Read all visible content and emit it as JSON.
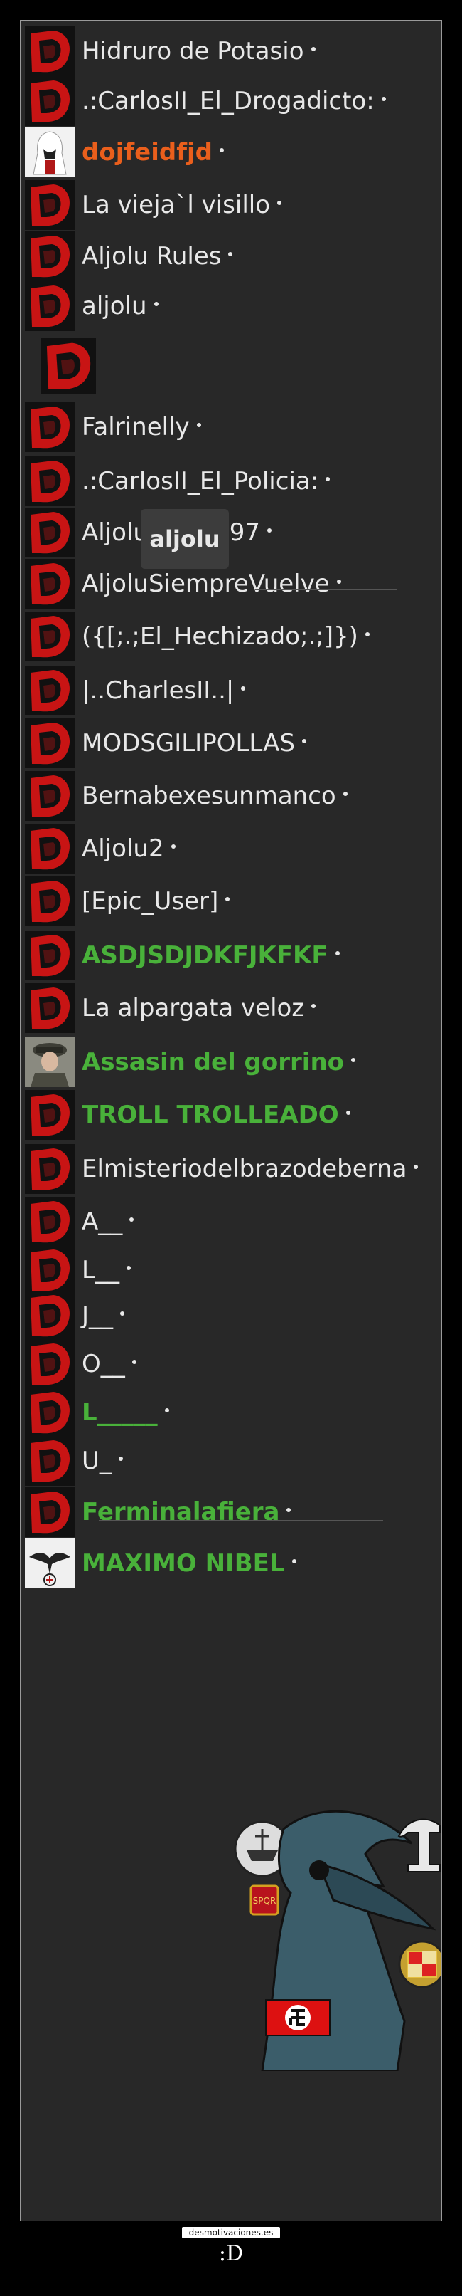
{
  "users": [
    {
      "name": "Hidruro de Potasio",
      "style": "normal",
      "avatar": "red-logo-icon"
    },
    {
      "name": ".:CarlosII_El_Drogadicto:",
      "style": "normal",
      "avatar": "red-logo-icon"
    },
    {
      "name": "dojfeidfjd",
      "style": "orange",
      "avatar": "assassin-avatar-icon"
    },
    {
      "name": "La vieja`l visillo",
      "style": "normal",
      "avatar": "red-logo-icon"
    },
    {
      "name": "Aljolu Rules",
      "style": "normal",
      "avatar": "red-logo-icon"
    },
    {
      "name": "aljolu",
      "style": "normal",
      "avatar": "red-logo-icon"
    },
    {
      "name": "",
      "style": "normal",
      "avatar": "red-logo-large-icon"
    },
    {
      "name": "Falrinelly",
      "style": "normal",
      "avatar": "red-logo-icon"
    },
    {
      "name": ".:CarlosII_El_Policia:",
      "style": "normal",
      "avatar": "red-logo-icon"
    },
    {
      "name": "AljoluCIIDCII97",
      "style": "normal",
      "avatar": "red-logo-icon"
    },
    {
      "name": "AljoluSiempreVuelve",
      "style": "normal",
      "avatar": "red-logo-icon"
    },
    {
      "name": "({[;.;El_Hechizado;.;]})",
      "style": "normal",
      "avatar": "red-logo-icon"
    },
    {
      "name": "|..CharlesII..|",
      "style": "normal",
      "avatar": "red-logo-icon"
    },
    {
      "name": "MODSGILIPOLLAS",
      "style": "normal",
      "avatar": "red-logo-icon"
    },
    {
      "name": "Bernabexesunmanco",
      "style": "normal",
      "avatar": "red-logo-icon"
    },
    {
      "name": "Aljolu2",
      "style": "normal",
      "avatar": "red-logo-icon"
    },
    {
      "name": "[Epic_User]",
      "style": "normal",
      "avatar": "red-logo-icon"
    },
    {
      "name": "ASDJSDJDKFJKFKF",
      "style": "green",
      "avatar": "red-logo-icon"
    },
    {
      "name": "La alpargata veloz",
      "style": "normal",
      "avatar": "red-logo-icon"
    },
    {
      "name": "Assasin del gorrino",
      "style": "green",
      "avatar": "officer-avatar-icon"
    },
    {
      "name": "TROLL TROLLEADO",
      "style": "green",
      "avatar": "red-logo-icon"
    },
    {
      "name": "Elmisteriodelbrazodeberna",
      "style": "normal",
      "avatar": "red-logo-icon"
    },
    {
      "name": "A__",
      "style": "normal",
      "avatar": "red-logo-icon"
    },
    {
      "name": "L__",
      "style": "normal",
      "avatar": "red-logo-icon"
    },
    {
      "name": "J__",
      "style": "normal",
      "avatar": "red-logo-icon"
    },
    {
      "name": "O__",
      "style": "normal",
      "avatar": "red-logo-icon"
    },
    {
      "name": "L_____",
      "style": "green",
      "avatar": "red-logo-icon"
    },
    {
      "name": "U_",
      "style": "normal",
      "avatar": "red-logo-icon"
    },
    {
      "name": "Ferminalafiera",
      "style": "green",
      "avatar": "red-logo-icon"
    },
    {
      "name": "MAXIMO NIBEL",
      "style": "green",
      "avatar": "eagle-emblem-icon"
    }
  ],
  "tooltip": {
    "label": "aljolu"
  },
  "sticker": {
    "icon": "plague-doctor-sticker-icon"
  },
  "footer": {
    "brand": "desmotivaciones.es",
    "caption": ":D"
  },
  "colors": {
    "background": "#282828",
    "green": "#49b13a",
    "orange": "#ea5f1c",
    "logo_red": "#c81414"
  }
}
